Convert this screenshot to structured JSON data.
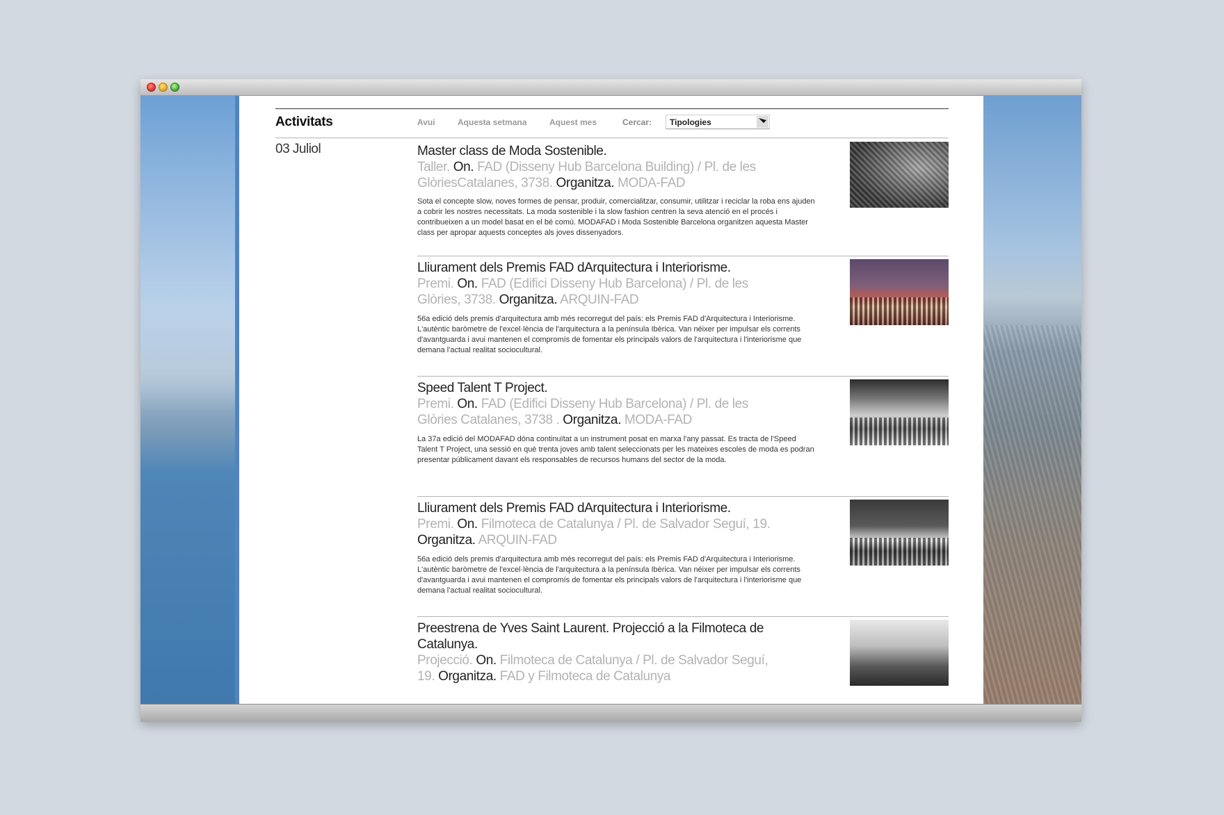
{
  "page": {
    "title": "Activitats",
    "nav": [
      "Avui",
      "Aquesta setmana",
      "Aquest mes"
    ],
    "search_label": "Cercar:",
    "search_value": "Tipologies"
  },
  "date": "03 Juliol",
  "events": [
    {
      "title": "Master class de Moda Sostenible.",
      "type": "Taller.",
      "on_label": "On.",
      "place": "FAD (Disseny Hub Barcelona Building) / Pl. de les GlòriesCatalanes, 3738.",
      "org_label": "Organitza.",
      "organizer": "MODA-FAD",
      "description": "Sota el concepte slow, noves formes de pensar, produir, comercialitzar, consumir, utilitzar i reciclar la roba ens ajuden a cobrir les nostres necessitats. La moda sostenible i la slow fashion centren la seva atenció en el procés i contribueixen a un model basat en el bé comú. MODAFAD i Moda Sostenible Barcelona organitzen aquesta Master class per apropar aquests conceptes als joves dissenyadors."
    },
    {
      "title": "Lliurament dels Premis FAD dArquitectura i Interiorisme.",
      "type": "Premi.",
      "on_label": "On.",
      "place": "FAD (Edifici Disseny Hub Barcelona) / Pl. de les Glòries, 3738.",
      "org_label": "Organitza.",
      "organizer": "ARQUIN-FAD",
      "description": "56a edició dels premis d'arquitectura amb més recorregut del país: els Premis FAD d'Arquitectura i Interiorisme. L'autèntic baròmetre de l'excel·lència de l'arquitectura a la península Ibèrica. Van néixer per impulsar els corrents d'avantguarda i avui mantenen el compromís de fomentar els principals valors de l'arquitectura i l'interiorisme que demana l'actual realitat sociocultural."
    },
    {
      "title": "Speed Talent T Project.",
      "type": "Premi.",
      "on_label": "On.",
      "place": "FAD (Edifici Disseny Hub Barcelona) / Pl. de les Glòries Catalanes, 3738 .",
      "org_label": "Organitza.",
      "organizer": "MODA-FAD",
      "description": "La 37a edició del MODAFAD dóna continuïtat a un instrument posat en marxa l'any passat. Es tracta de l'Speed Talent T Project, una sessió en què trenta joves amb talent seleccionats per les mateixes escoles de moda es podran presentar públicament davant els responsables de recursos humans del sector de la moda."
    },
    {
      "title": "Lliurament dels Premis FAD dArquitectura i Interiorisme.",
      "type": "Premi.",
      "on_label": "On.",
      "place": "Filmoteca de Catalunya / Pl. de Salvador Seguí, 19.",
      "org_label": "Organitza.",
      "organizer": "ARQUIN-FAD",
      "description": "56a edició dels premis d'arquitectura amb més recorregut del país: els Premis FAD d'Arquitectura i Interiorisme. L'autèntic baròmetre de l'excel·lència de l'arquitectura a la península Ibèrica. Van néixer per impulsar els corrents d'avantguarda i avui mantenen el compromís de fomentar els principals valors de l'arquitectura i l'interiorisme que demana l'actual realitat sociocultural."
    },
    {
      "title": "Preestrena de Yves Saint Laurent. Projecció a la Filmoteca de Catalunya.",
      "type": "Projecció.",
      "on_label": "On.",
      "place": "Filmoteca de Catalunya / Pl. de Salvador Seguí, 19.",
      "org_label": "Organitza.",
      "organizer": "FAD y Filmoteca de Catalunya",
      "description": ""
    }
  ]
}
